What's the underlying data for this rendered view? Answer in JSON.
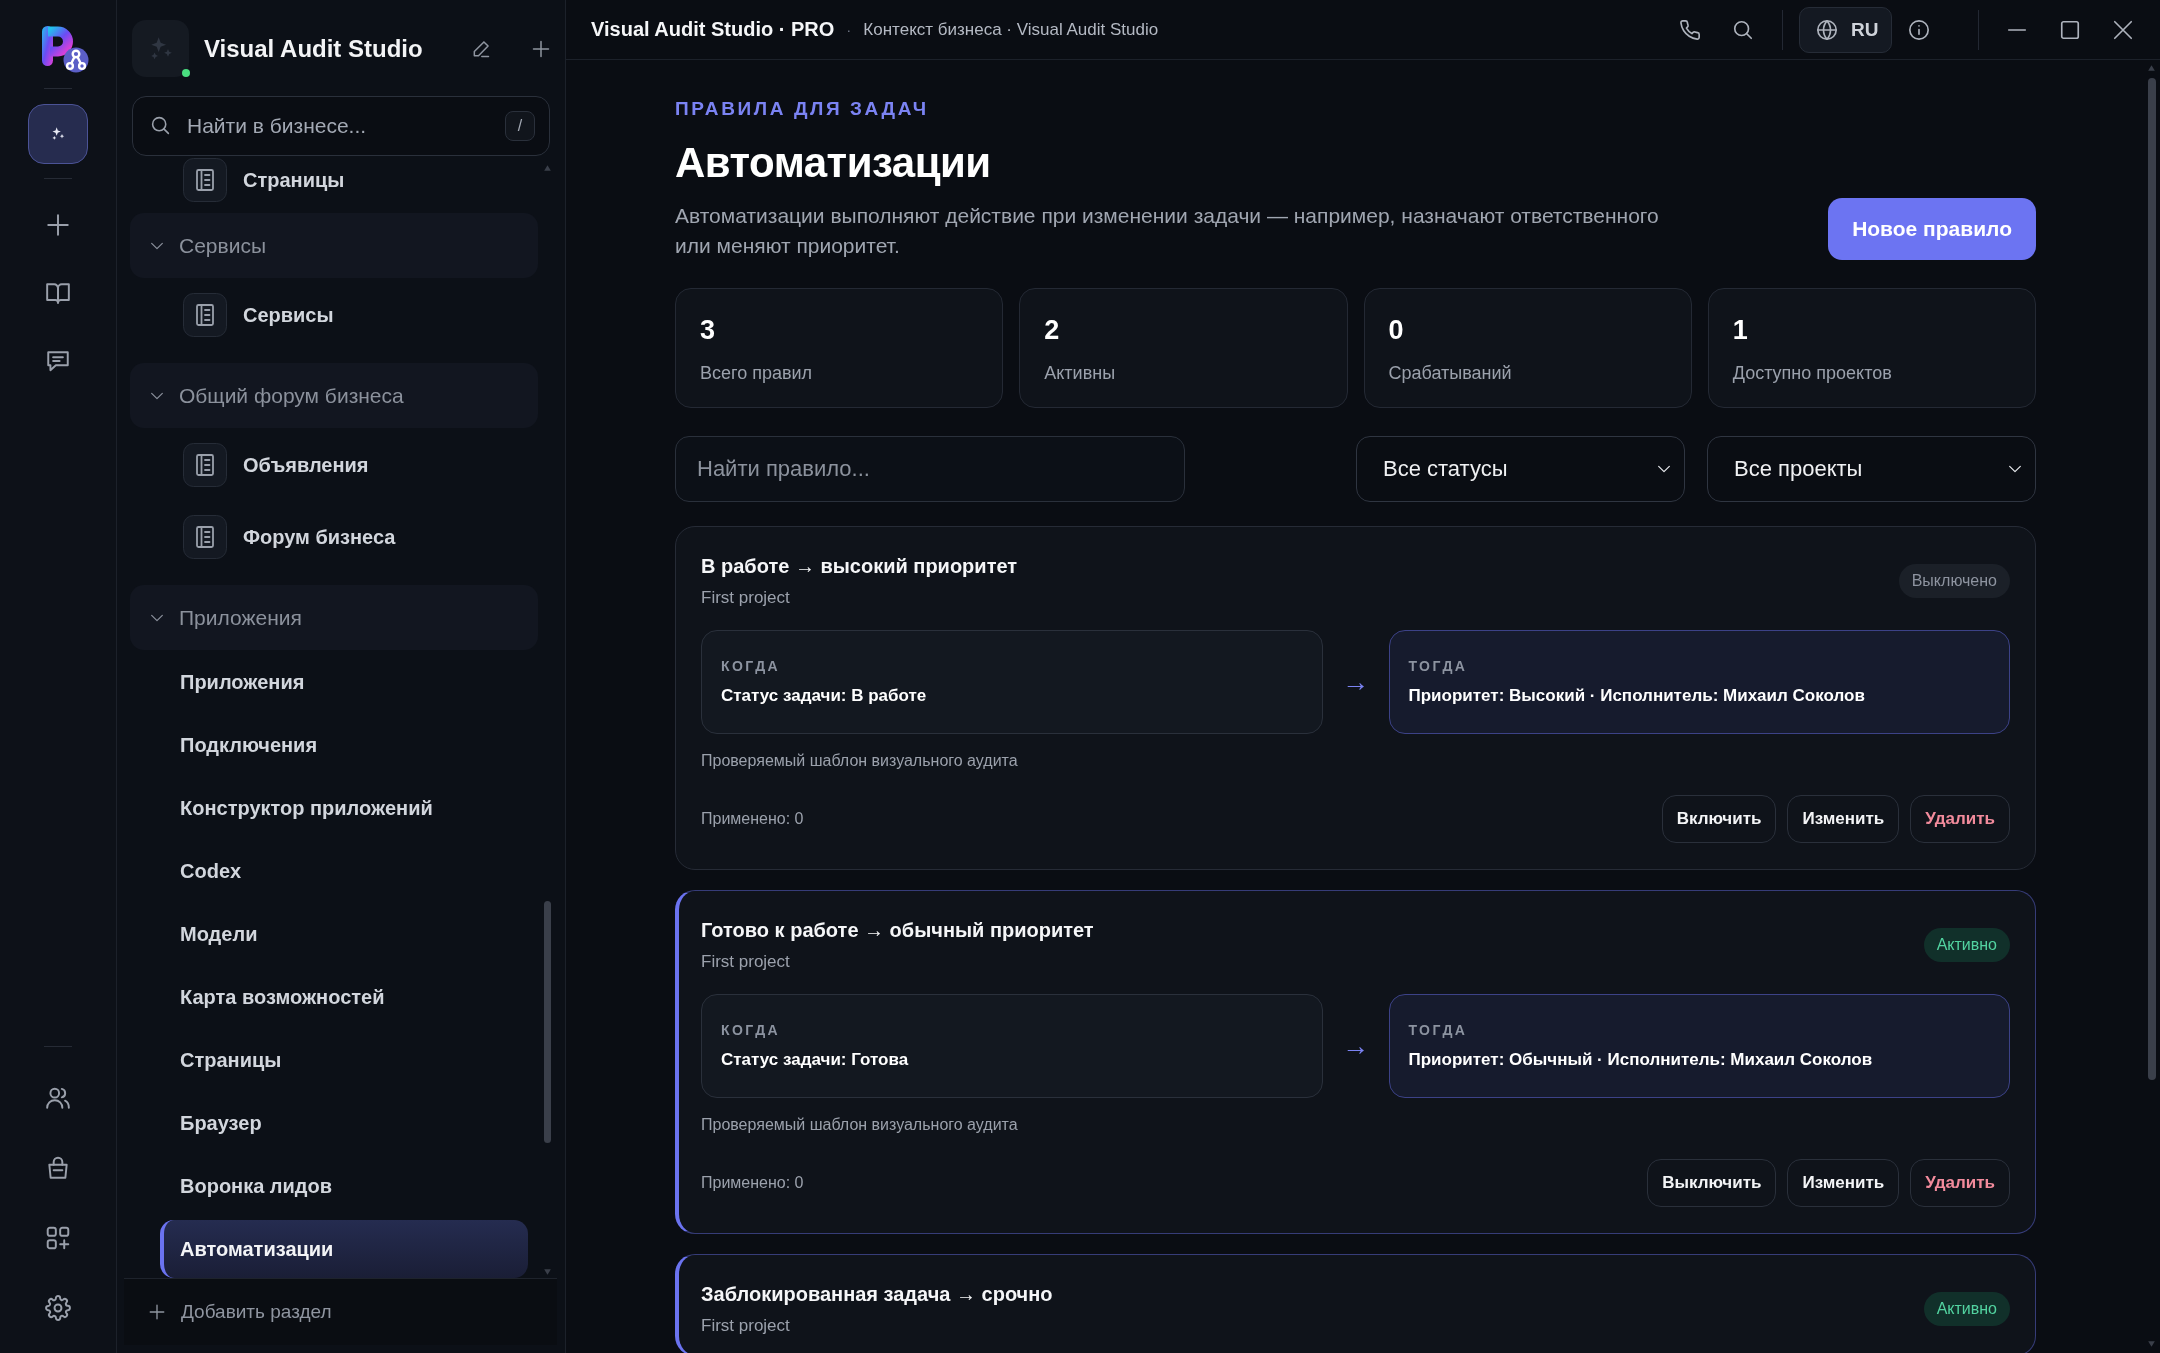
{
  "rail": {
    "items": [
      {
        "selected": true
      },
      {
        "selected": false
      },
      {
        "selected": false
      },
      {
        "selected": false
      }
    ]
  },
  "sidebar": {
    "title": "Visual Audit Studio",
    "online": true,
    "search": {
      "placeholder": "Найти в бизнесе...",
      "shortcut": "/"
    },
    "tree": [
      {
        "kind": "page",
        "label": "Страницы",
        "selected": false
      },
      {
        "kind": "group",
        "label": "Сервисы",
        "expanded": true,
        "children": [
          {
            "kind": "page",
            "label": "Сервисы",
            "selected": false
          }
        ]
      },
      {
        "kind": "group",
        "label": "Общий форум бизнеса",
        "expanded": true,
        "children": [
          {
            "kind": "page",
            "label": "Объявления",
            "selected": false
          },
          {
            "kind": "page",
            "label": "Форум бизнеса",
            "selected": false
          }
        ]
      },
      {
        "kind": "group",
        "label": "Приложения",
        "expanded": true,
        "children": [
          {
            "kind": "link",
            "label": "Приложения",
            "selected": false
          },
          {
            "kind": "link",
            "label": "Подключения",
            "selected": false
          },
          {
            "kind": "link",
            "label": "Конструктор приложений",
            "selected": false
          },
          {
            "kind": "link",
            "label": "Codex",
            "selected": false
          },
          {
            "kind": "link",
            "label": "Модели",
            "selected": false
          },
          {
            "kind": "link",
            "label": "Карта возможностей",
            "selected": false
          },
          {
            "kind": "link",
            "label": "Страницы",
            "selected": false
          },
          {
            "kind": "link",
            "label": "Браузер",
            "selected": false
          },
          {
            "kind": "link",
            "label": "Воронка лидов",
            "selected": false
          },
          {
            "kind": "link",
            "label": "Автоматизации",
            "selected": true
          }
        ]
      }
    ],
    "footer": "Добавить раздел"
  },
  "topbar": {
    "title": "Visual Audit Studio · PRO",
    "separator": "·",
    "breadcrumb": "Контекст бизнеса · Visual Audit Studio",
    "language": "RU"
  },
  "header": {
    "eyebrow": "ПРАВИЛА ДЛЯ ЗАДАЧ",
    "title": "Автоматизации",
    "description": "Автоматизации выполняют действие при изменении задачи — например, назначают ответственного или меняют приоритет.",
    "button": "Новое правило"
  },
  "stats": [
    {
      "value": "3",
      "label": "Всего правил"
    },
    {
      "value": "2",
      "label": "Активны"
    },
    {
      "value": "0",
      "label": "Срабатываний"
    },
    {
      "value": "1",
      "label": "Доступно проектов"
    }
  ],
  "filters": {
    "search": {
      "placeholder": "Найти правило..."
    },
    "status": "Все статусы",
    "project": "Все проекты"
  },
  "rules": [
    {
      "title": "В работе → высокий приоритет",
      "project": "First project",
      "active": false,
      "status": "Выключено",
      "when": {
        "label": "КОГДА",
        "value": "Статус задачи: В работе"
      },
      "arrow": "→",
      "then": {
        "label": "ТОГДА",
        "value": "Приоритет: Высокий · Исполнитель: Михаил Соколов"
      },
      "template": "Проверяемый шаблон визуального аудита",
      "applied": "Применено: 0",
      "actions": [
        {
          "label": "Включить",
          "kind": "toggle"
        },
        {
          "label": "Изменить",
          "kind": "edit"
        },
        {
          "label": "Удалить",
          "kind": "delete"
        }
      ]
    },
    {
      "title": "Готово к работе → обычный приоритет",
      "project": "First project",
      "active": true,
      "status": "Активно",
      "when": {
        "label": "КОГДА",
        "value": "Статус задачи: Готова"
      },
      "arrow": "→",
      "then": {
        "label": "ТОГДА",
        "value": "Приоритет: Обычный · Исполнитель: Михаил Соколов"
      },
      "template": "Проверяемый шаблон визуального аудита",
      "applied": "Применено: 0",
      "actions": [
        {
          "label": "Выключить",
          "kind": "toggle"
        },
        {
          "label": "Изменить",
          "kind": "edit"
        },
        {
          "label": "Удалить",
          "kind": "delete"
        }
      ]
    },
    {
      "title": "Заблокированная задача → срочно",
      "project": "First project",
      "active": true,
      "status": "Активно"
    }
  ]
}
